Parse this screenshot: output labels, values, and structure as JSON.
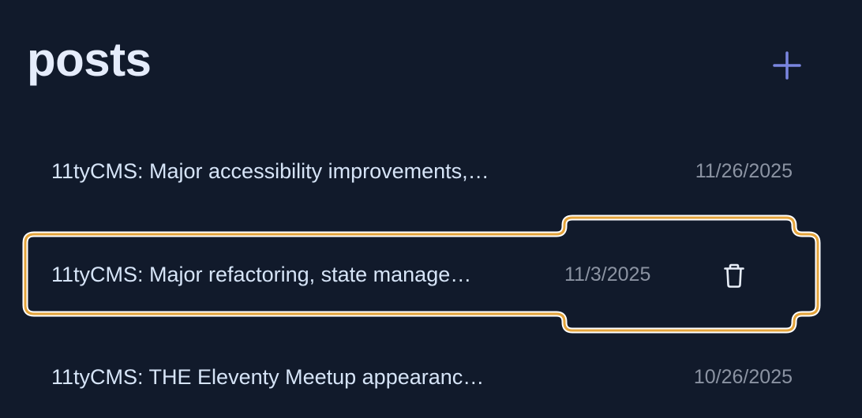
{
  "header": {
    "title": "posts",
    "add_icon": "plus-icon"
  },
  "posts": [
    {
      "title": "11tyCMS: Major accessibility improvements,…",
      "date": "11/26/2025"
    },
    {
      "title": "11tyCMS: Major refactoring, state manage…",
      "date": "11/3/2025",
      "focused": true,
      "delete_icon": "trash-icon"
    },
    {
      "title": "11tyCMS: THE Eleventy Meetup appearanc…",
      "date": "10/26/2025"
    }
  ],
  "colors": {
    "background": "#111a2b",
    "title": "#e5ecfb",
    "post_text": "#d6e4f7",
    "date_text": "#8b93a2",
    "accent_plus": "#7a86e0",
    "focus_ring": "#e3a33a"
  }
}
